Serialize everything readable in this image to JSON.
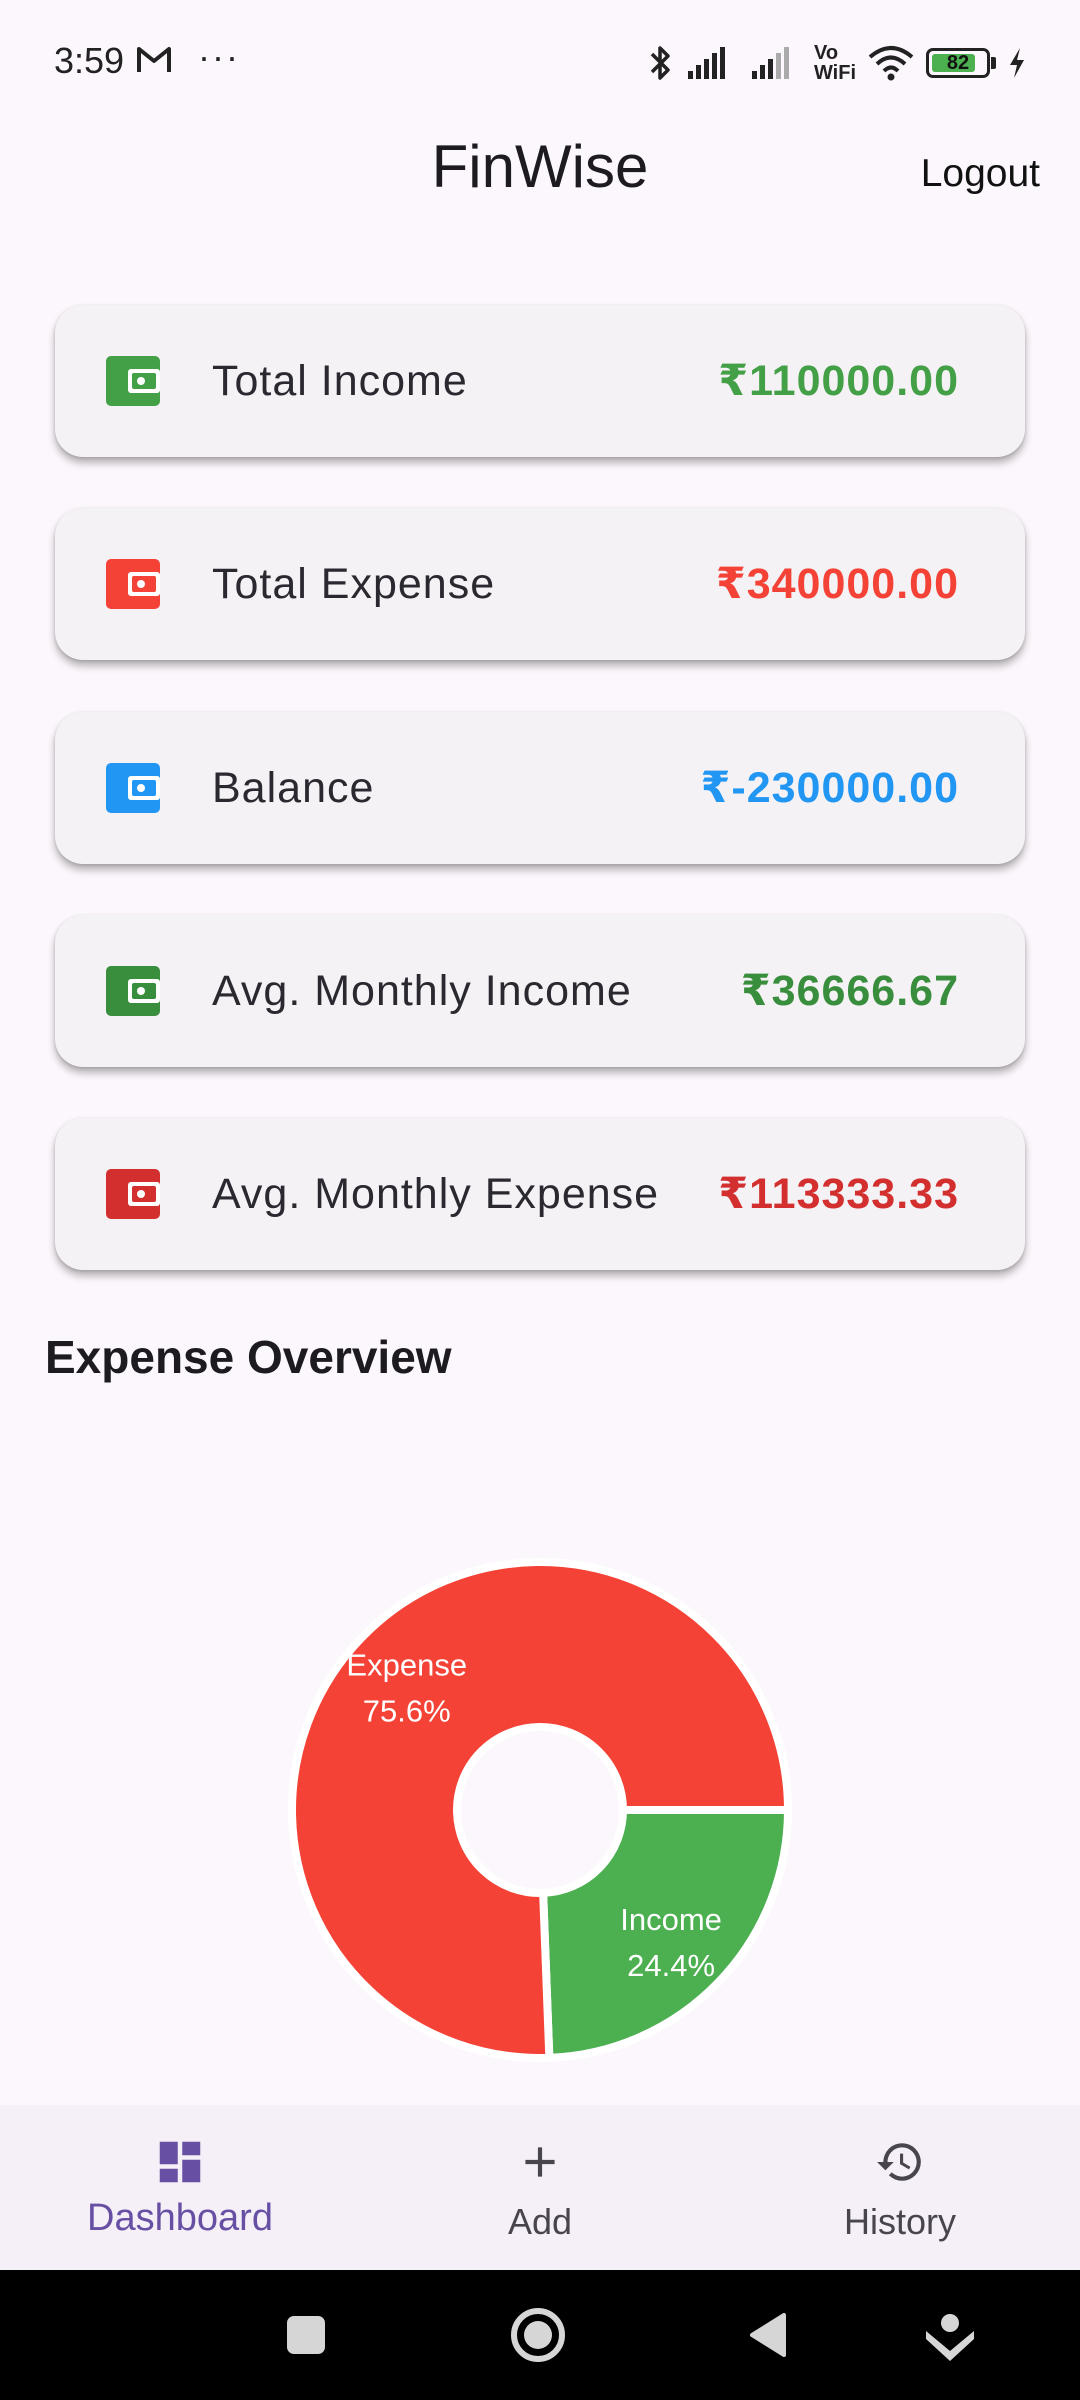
{
  "status_bar": {
    "time": "3:59",
    "more_dots": "···",
    "battery_level": "82",
    "battery_fraction": 0.82,
    "icons": [
      "gmail-icon",
      "bluetooth-icon",
      "signal-icon",
      "signal-icon",
      "vowifi-icon",
      "wifi-icon",
      "battery-icon",
      "charging-icon"
    ],
    "vowifi_top": "Vo",
    "vowifi_bottom": "WiFi"
  },
  "app_bar": {
    "title": "FinWise",
    "logout_label": "Logout"
  },
  "cards": [
    {
      "label": "Total Income",
      "value": "₹110000.00",
      "color": "#43a047",
      "icon": "wallet-icon"
    },
    {
      "label": "Total Expense",
      "value": "₹340000.00",
      "color": "#f44336",
      "icon": "wallet-icon"
    },
    {
      "label": "Balance",
      "value": "₹-230000.00",
      "color": "#2196f3",
      "icon": "wallet-icon"
    },
    {
      "label": "Avg. Monthly Income",
      "value": "₹36666.67",
      "color": "#388e3c",
      "icon": "wallet-icon"
    },
    {
      "label": "Avg. Monthly Expense",
      "value": "₹113333.33",
      "color": "#d32f2f",
      "icon": "wallet-icon"
    }
  ],
  "overview": {
    "title": "Expense Overview"
  },
  "chart_data": {
    "type": "pie",
    "donut": true,
    "slices": [
      {
        "name": "Expense",
        "value": 75.6,
        "label": "Expense",
        "percent_label": "75.6%",
        "color": "#f44336"
      },
      {
        "name": "Income",
        "value": 24.4,
        "label": "Income",
        "percent_label": "24.4%",
        "color": "#4caf50"
      }
    ]
  },
  "bottom_nav": {
    "items": [
      {
        "label": "Dashboard",
        "icon": "dashboard-icon",
        "active": true
      },
      {
        "label": "Add",
        "icon": "add-icon",
        "active": false
      },
      {
        "label": "History",
        "icon": "history-icon",
        "active": false
      }
    ],
    "active_color": "#6750a4"
  },
  "system_nav": {
    "icons": [
      "recents-icon",
      "home-icon",
      "back-icon",
      "assistant-icon"
    ]
  }
}
